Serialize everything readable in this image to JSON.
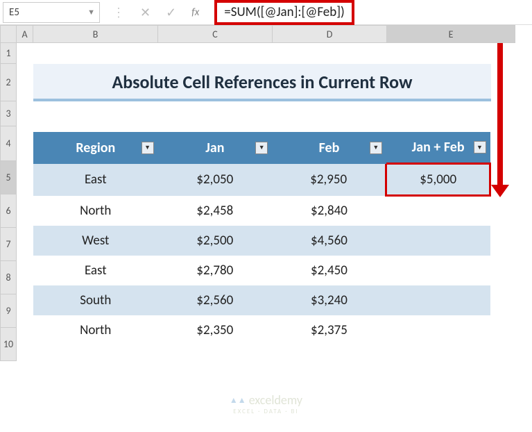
{
  "namebox": "E5",
  "formula": "=SUM([@Jan]:[@Feb])",
  "col_headers": [
    "A",
    "B",
    "C",
    "D",
    "E"
  ],
  "row_headers": [
    "1",
    "2",
    "3",
    "4",
    "5",
    "6",
    "7",
    "8",
    "9",
    "10"
  ],
  "title": "Absolute Cell References in Current Row",
  "table": {
    "headers": [
      "Region",
      "Jan",
      "Feb",
      "Jan + Feb"
    ],
    "rows": [
      {
        "region": "East",
        "jan": "$2,050",
        "feb": "$2,950",
        "sum": "$5,000"
      },
      {
        "region": "North",
        "jan": "$2,458",
        "feb": "$2,840",
        "sum": ""
      },
      {
        "region": "West",
        "jan": "$2,500",
        "feb": "$4,560",
        "sum": ""
      },
      {
        "region": "East",
        "jan": "$2,780",
        "feb": "$2,450",
        "sum": ""
      },
      {
        "region": "South",
        "jan": "$2,560",
        "feb": "$3,240",
        "sum": ""
      },
      {
        "region": "North",
        "jan": "$2,350",
        "feb": "$2,375",
        "sum": ""
      }
    ]
  },
  "watermark": {
    "main": "exceldemy",
    "sub": "EXCEL · DATA · BI"
  },
  "chart_data": {
    "type": "table",
    "title": "Absolute Cell References in Current Row",
    "columns": [
      "Region",
      "Jan",
      "Feb",
      "Jan + Feb"
    ],
    "data": [
      [
        "East",
        2050,
        2950,
        5000
      ],
      [
        "North",
        2458,
        2840,
        null
      ],
      [
        "West",
        2500,
        4560,
        null
      ],
      [
        "East",
        2780,
        2450,
        null
      ],
      [
        "South",
        2560,
        3240,
        null
      ],
      [
        "North",
        2350,
        2375,
        null
      ]
    ],
    "formula_cell": {
      "ref": "E5",
      "formula": "=SUM([@Jan]:[@Feb])"
    }
  }
}
